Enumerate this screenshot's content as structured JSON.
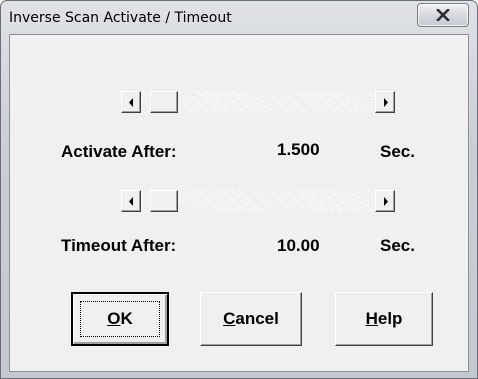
{
  "window": {
    "title": "Inverse Scan Activate / Timeout"
  },
  "activate": {
    "label": "Activate After:",
    "value": "1.500",
    "unit": "Sec."
  },
  "timeout": {
    "label": "Timeout After:",
    "value": "10.00",
    "unit": "Sec."
  },
  "buttons": {
    "ok": {
      "mnemonic": "O",
      "rest": "K"
    },
    "cancel": {
      "mnemonic": "C",
      "rest": "ancel"
    },
    "help": {
      "mnemonic": "H",
      "rest": "elp"
    }
  },
  "icons": {
    "close": "close-icon",
    "left": "arrow-left-icon",
    "right": "arrow-right-icon"
  }
}
